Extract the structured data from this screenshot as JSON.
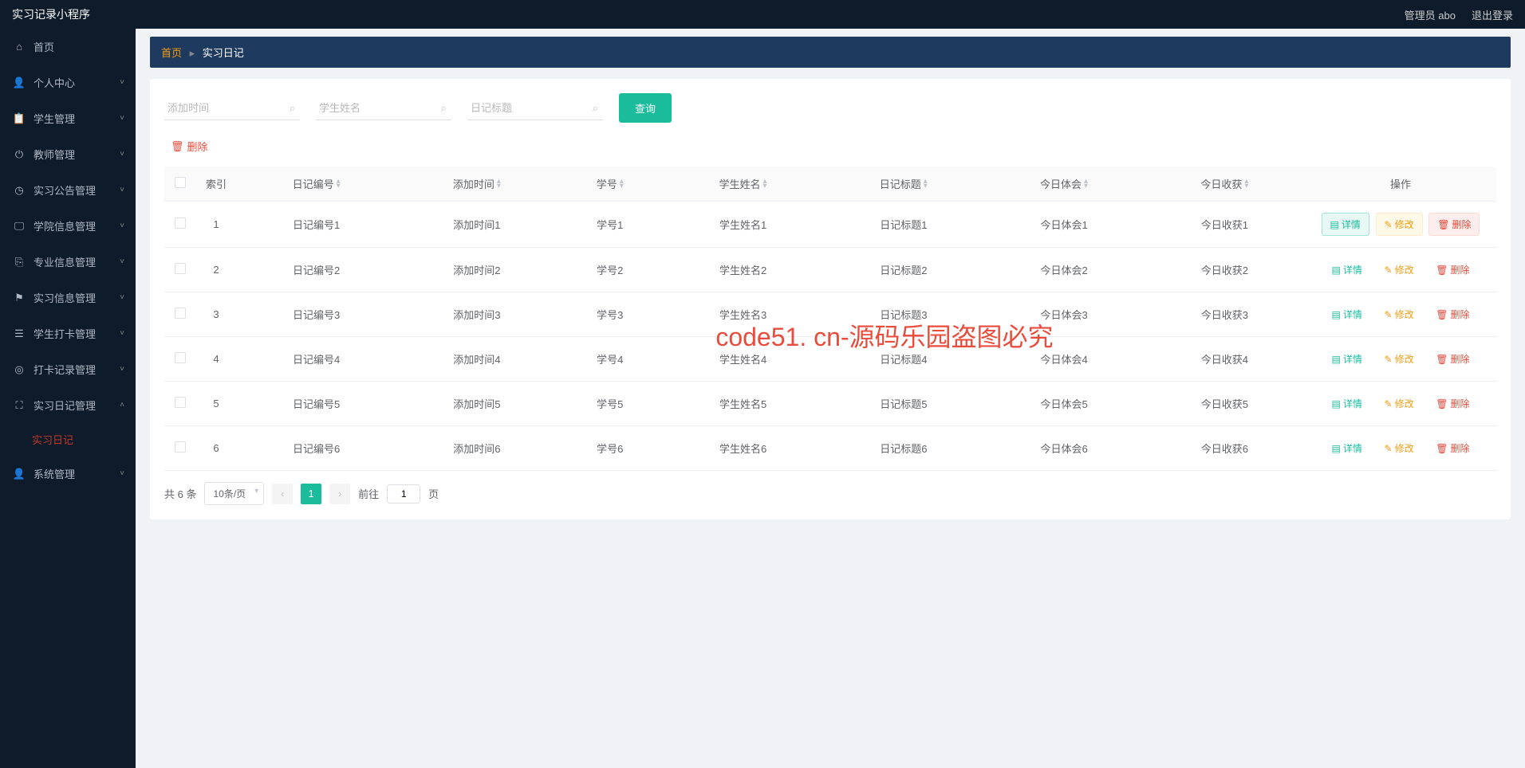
{
  "header": {
    "title": "实习记录小程序",
    "admin": "管理员 abo",
    "logout": "退出登录"
  },
  "sidebar": {
    "items": [
      {
        "icon": "home",
        "label": "首页",
        "arrow": false
      },
      {
        "icon": "user",
        "label": "个人中心",
        "arrow": true
      },
      {
        "icon": "clipboard",
        "label": "学生管理",
        "arrow": true
      },
      {
        "icon": "power",
        "label": "教师管理",
        "arrow": true
      },
      {
        "icon": "clock",
        "label": "实习公告管理",
        "arrow": true
      },
      {
        "icon": "monitor",
        "label": "学院信息管理",
        "arrow": true
      },
      {
        "icon": "copy",
        "label": "专业信息管理",
        "arrow": true
      },
      {
        "icon": "flag",
        "label": "实习信息管理",
        "arrow": true
      },
      {
        "icon": "list",
        "label": "学生打卡管理",
        "arrow": true
      },
      {
        "icon": "target",
        "label": "打卡记录管理",
        "arrow": true
      },
      {
        "icon": "expand",
        "label": "实习日记管理",
        "arrow": true,
        "expanded": true
      },
      {
        "icon": "user",
        "label": "系统管理",
        "arrow": true
      }
    ],
    "active_sub": "实习日记"
  },
  "breadcrumb": {
    "home": "首页",
    "current": "实习日记"
  },
  "filters": {
    "time_ph": "添加时间",
    "name_ph": "学生姓名",
    "title_ph": "日记标题",
    "query": "查询"
  },
  "toolbar": {
    "delete": "删除"
  },
  "table": {
    "headers": {
      "index": "索引",
      "diary_no": "日记编号",
      "add_time": "添加时间",
      "student_no": "学号",
      "student_name": "学生姓名",
      "title": "日记标题",
      "experience": "今日体会",
      "harvest": "今日收获",
      "action": "操作"
    },
    "rows": [
      {
        "idx": "1",
        "no": "日记编号1",
        "time": "添加时间1",
        "sno": "学号1",
        "sname": "学生姓名1",
        "title": "日记标题1",
        "exp": "今日体会1",
        "harv": "今日收获1"
      },
      {
        "idx": "2",
        "no": "日记编号2",
        "time": "添加时间2",
        "sno": "学号2",
        "sname": "学生姓名2",
        "title": "日记标题2",
        "exp": "今日体会2",
        "harv": "今日收获2"
      },
      {
        "idx": "3",
        "no": "日记编号3",
        "time": "添加时间3",
        "sno": "学号3",
        "sname": "学生姓名3",
        "title": "日记标题3",
        "exp": "今日体会3",
        "harv": "今日收获3"
      },
      {
        "idx": "4",
        "no": "日记编号4",
        "time": "添加时间4",
        "sno": "学号4",
        "sname": "学生姓名4",
        "title": "日记标题4",
        "exp": "今日体会4",
        "harv": "今日收获4"
      },
      {
        "idx": "5",
        "no": "日记编号5",
        "time": "添加时间5",
        "sno": "学号5",
        "sname": "学生姓名5",
        "title": "日记标题5",
        "exp": "今日体会5",
        "harv": "今日收获5"
      },
      {
        "idx": "6",
        "no": "日记编号6",
        "time": "添加时间6",
        "sno": "学号6",
        "sname": "学生姓名6",
        "title": "日记标题6",
        "exp": "今日体会6",
        "harv": "今日收获6"
      }
    ],
    "actions": {
      "detail": "详情",
      "edit": "修改",
      "del": "删除"
    }
  },
  "pagination": {
    "total": "共 6 条",
    "per_page": "10条/页",
    "goto_prefix": "前往",
    "goto_suffix": "页",
    "current": "1"
  },
  "overlay": "code51. cn-源码乐园盗图必究",
  "watermark": "code51.cn"
}
